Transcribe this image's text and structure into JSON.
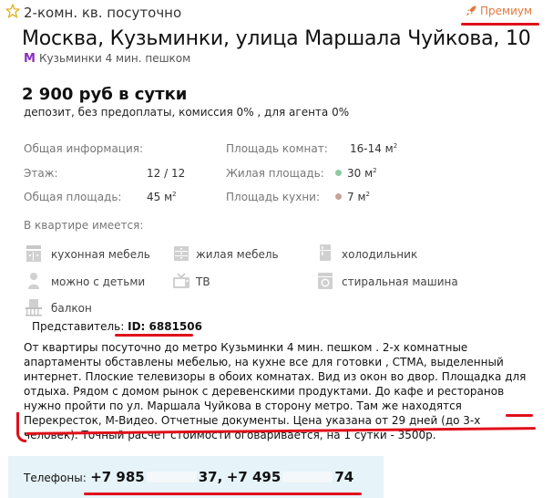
{
  "listing": {
    "type": "2-комн. кв. посуточно",
    "premium_label": "Премиум",
    "address": "Москва, Кузьминки, улица Маршала Чуйкова, 10",
    "metro": "Кузьминки 4 мин. пешком",
    "price": "2 900 руб в сутки",
    "terms": "депозит, без предоплаты, комиссия 0% , для агента 0%"
  },
  "info": {
    "general_label": "Общая информация:",
    "floor_label": "Этаж:",
    "floor_value": "12 / 12",
    "total_area_label": "Общая площадь:",
    "total_area_value": "45 м",
    "rooms_area_label": "Площадь комнат:",
    "rooms_area_value": "16-14 м",
    "living_area_label": "Жилая площадь:",
    "living_area_value": "30 м",
    "kitchen_area_label": "Площадь кухни:",
    "kitchen_area_value": "7 м",
    "sup": "2"
  },
  "amenities": {
    "header": "В квартире имеется:",
    "items": [
      {
        "label": "кухонная мебель",
        "icon": "kitchen-furniture-icon"
      },
      {
        "label": "жилая мебель",
        "icon": "living-furniture-icon"
      },
      {
        "label": "холодильник",
        "icon": "fridge-icon"
      },
      {
        "label": "можно с детьми",
        "icon": "children-icon"
      },
      {
        "label": "ТВ",
        "icon": "tv-icon"
      },
      {
        "label": "стиральная машина",
        "icon": "washing-machine-icon"
      },
      {
        "label": "балкон",
        "icon": "balcony-icon"
      }
    ]
  },
  "representative": {
    "label": "Представитель:",
    "id": "ID: 6881506"
  },
  "description": {
    "text": "От квартиры посуточно до метро Кузьминки 4 мин. пешком . 2-х комнатные апартаменты обставлены мебелью, на кухне все для готовки , СТМА, выделенный интернет. Плоские телевизоры в обоих комнатах. Вид из окон во двор. Площадка для отдыха. Рядом с домом рынок с деревенскими продуктами. До кафе и ресторанов нужно пройти по ул. Маршала Чуйкова в сторону метро. Там же находятся Перекресток, М-Видео. Отчетные документы. Цена указана от 29 дней (до 3-х человек). Точный расчет стоимости оговаривается, на 1 сутки - 3500р."
  },
  "phones": {
    "label": "Телефоны:",
    "phone1_start": "+7 985",
    "phone1_end": "37",
    "separator": ",",
    "phone2_start": "+7 495",
    "phone2_end": "74"
  },
  "colors": {
    "accent_red": "#e0101a",
    "premium_orange": "#e07a40",
    "metro_purple": "#8b2fbf",
    "phones_bg": "#e6f3f8",
    "living_dot": "#8fc9a0",
    "kitchen_dot": "#c9a29c"
  }
}
